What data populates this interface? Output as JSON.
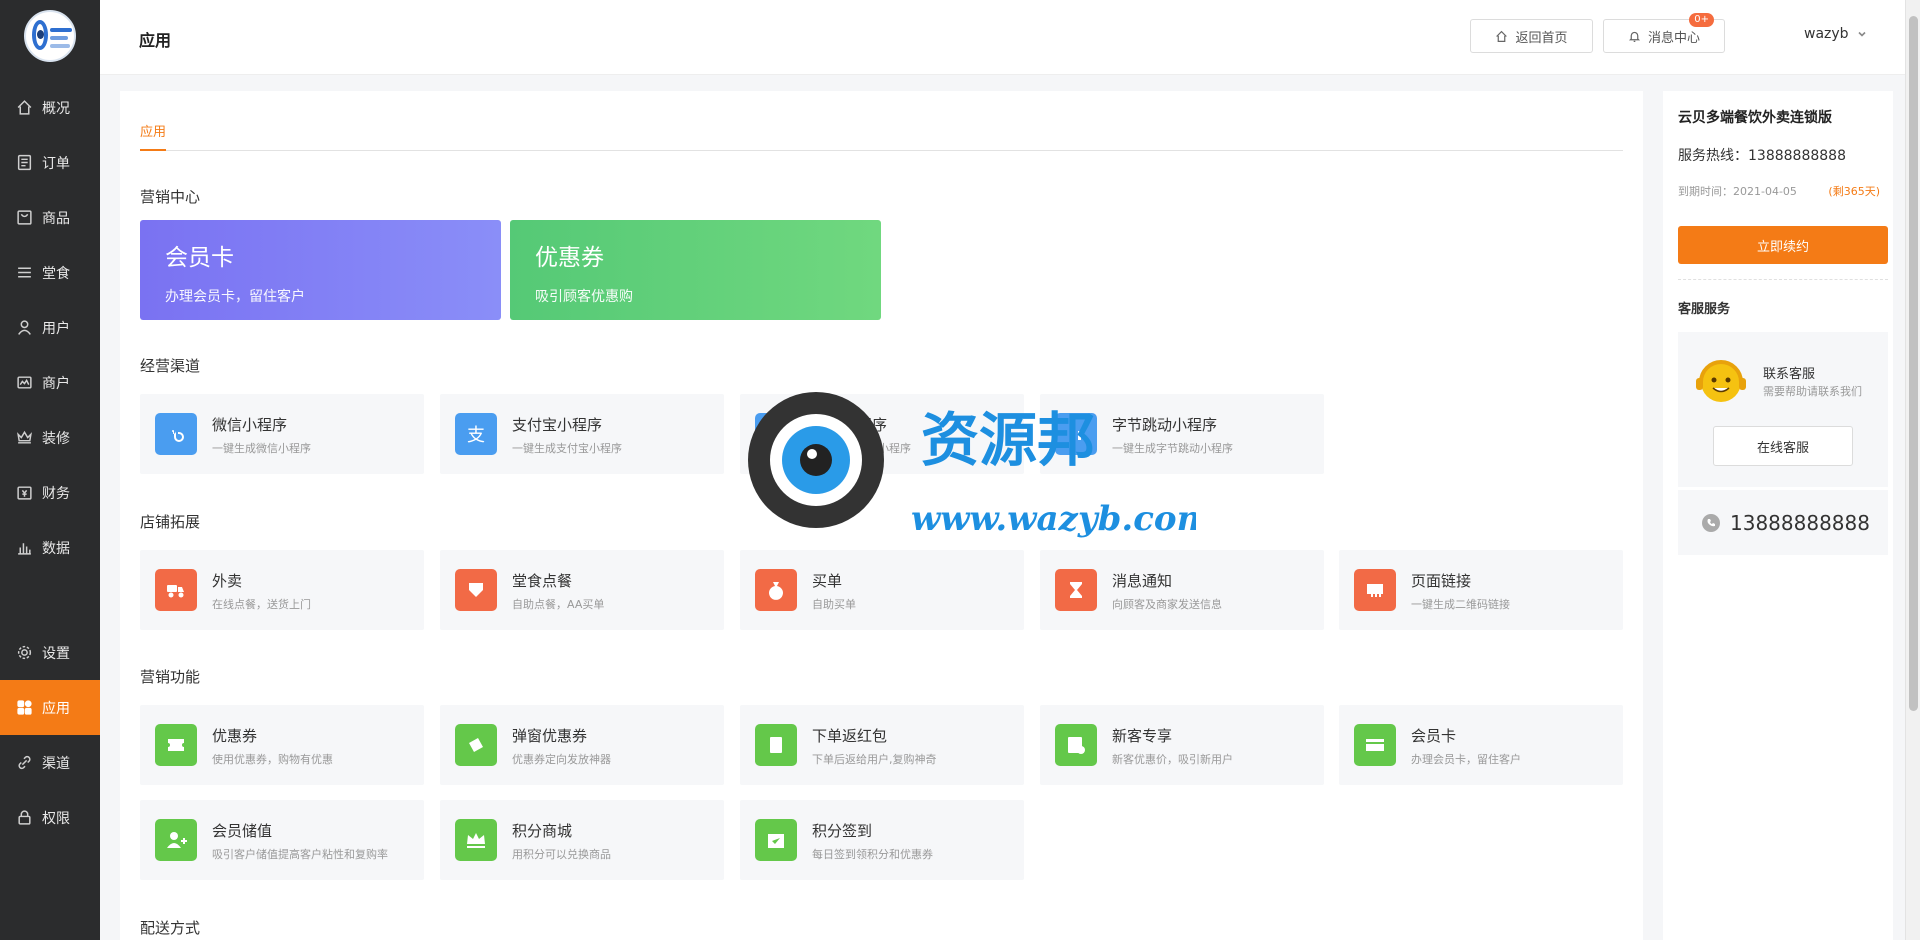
{
  "sidebar": {
    "logo": "logo",
    "items": [
      {
        "label": "概况",
        "icon": "home-icon"
      },
      {
        "label": "订单",
        "icon": "order-icon"
      },
      {
        "label": "商品",
        "icon": "goods-icon"
      },
      {
        "label": "堂食",
        "icon": "menu-icon"
      },
      {
        "label": "用户",
        "icon": "user-icon"
      },
      {
        "label": "商户",
        "icon": "store-icon"
      },
      {
        "label": "装修",
        "icon": "decorate-icon"
      },
      {
        "label": "财务",
        "icon": "finance-icon"
      },
      {
        "label": "数据",
        "icon": "chart-icon"
      },
      {
        "label": "设置",
        "icon": "settings-icon"
      },
      {
        "label": "应用",
        "icon": "apps-icon",
        "active": true
      },
      {
        "label": "渠道",
        "icon": "channel-icon"
      },
      {
        "label": "权限",
        "icon": "lock-icon"
      }
    ]
  },
  "header": {
    "title": "应用",
    "home_label": "返回首页",
    "msg_label": "消息中心",
    "msg_badge": "0+",
    "username": "wazyb"
  },
  "main": {
    "tab": "应用",
    "sections": {
      "marketing_center": "营销中心",
      "channels": "经营渠道",
      "store_ext": "店铺拓展",
      "marketing_func": "营销功能",
      "delivery": "配送方式"
    },
    "big_cards": [
      {
        "title": "会员卡",
        "desc": "办理会员卡，留住客户"
      },
      {
        "title": "优惠券",
        "desc": "吸引顾客优惠购"
      }
    ],
    "channels": [
      {
        "name": "微信小程序",
        "desc": "一键生成微信小程序"
      },
      {
        "name": "支付宝小程序",
        "desc": "一键生成支付宝小程序"
      },
      {
        "name": "百度小程序",
        "desc": "一键生成百度小程序"
      },
      {
        "name": "字节跳动小程序",
        "desc": "一键生成字节跳动小程序"
      }
    ],
    "store_ext": [
      {
        "name": "外卖",
        "desc": "在线点餐，送货上门"
      },
      {
        "name": "堂食点餐",
        "desc": "自助点餐，AA买单"
      },
      {
        "name": "买单",
        "desc": "自助买单"
      },
      {
        "name": "消息通知",
        "desc": "向顾客及商家发送信息"
      },
      {
        "name": "页面链接",
        "desc": "一键生成二维码链接"
      }
    ],
    "marketing": [
      {
        "name": "优惠券",
        "desc": "使用优惠券，购物有优惠"
      },
      {
        "name": "弹窗优惠券",
        "desc": "优惠券定向发放神器"
      },
      {
        "name": "下单返红包",
        "desc": "下单后返给用户,复购神奇"
      },
      {
        "name": "新客专享",
        "desc": "新客优惠价，吸引新用户"
      },
      {
        "name": "会员卡",
        "desc": "办理会员卡，留住客户"
      },
      {
        "name": "会员储值",
        "desc": "吸引客户储值提高客户粘性和复购率"
      },
      {
        "name": "积分商城",
        "desc": "用积分可以兑换商品"
      },
      {
        "name": "积分签到",
        "desc": "每日签到领积分和优惠券"
      }
    ]
  },
  "watermark": {
    "text": "资源邦",
    "url": "www.wazyb.com"
  },
  "right": {
    "title": "云贝多端餐饮外卖连锁版",
    "hotline": "服务热线：13888888888",
    "expire": "到期时间：2021-04-05",
    "remaining": "(剩365天)",
    "renew": "立即续约",
    "service_title": "客服服务",
    "contact": "联系客服",
    "contact_desc": "需要帮助请联系我们",
    "online": "在线客服",
    "phone": "13888888888"
  },
  "colors": {
    "accent": "#f47b16",
    "sidebar_bg": "#2b2c2d",
    "member_card": "#7a72f2",
    "coupon_card": "#55c976",
    "icon_blue": "#4a9df0",
    "icon_orange": "#f26a46",
    "icon_green": "#64c84a"
  }
}
